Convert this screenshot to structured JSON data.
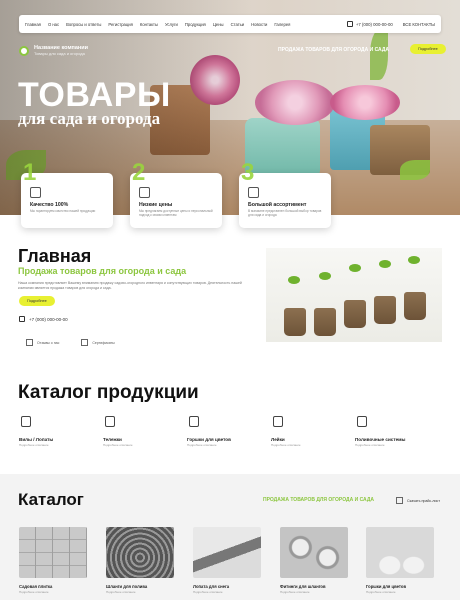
{
  "nav": {
    "items": [
      "Главная",
      "О нас",
      "Вопросы и ответы",
      "Регистрация",
      "Контакты",
      "Услуги",
      "Продукция",
      "Цены",
      "Статьи",
      "Новости",
      "Галерея"
    ],
    "phone": "+7 (000) 000-00-00",
    "contacts": "ВСЕ КОНТАКТЫ"
  },
  "brand": {
    "name": "Название компании",
    "tagline": "Товары для сада и огорода"
  },
  "hero": {
    "tag": "Продажа товаров для огорода и сада",
    "button": "Подробнее",
    "title": "ТОВАРЫ",
    "subtitle": "для сада и огорода"
  },
  "features": [
    {
      "num": "1",
      "title": "Качество 100%",
      "desc": "Мы гарантируем качество нашей продукции"
    },
    {
      "num": "2",
      "title": "Низкие цены",
      "desc": "Мы предлагаем доступные цены и персональный подход к своим клиентам"
    },
    {
      "num": "3",
      "title": "Большой ассортимент",
      "desc": "В магазине представлен большой выбор товаров для сада и огорода"
    }
  ],
  "main": {
    "title": "Главная",
    "subtitle": "Продажа товаров для огорода и сада",
    "desc": "Наша компания представляет Вашему вниманию продажу садово-огородного инвентаря и сопутствующих товаров. Деятельность нашей компании является продажа товаров для огорода и сада.",
    "button": "Подробнее",
    "phone": "+7 (000) 000-00-00",
    "links": [
      "Отзывы о нас",
      "Сертификаты"
    ]
  },
  "catalog_products": {
    "title": "Каталог продукции",
    "items": [
      {
        "title": "Вилы / Лопаты",
        "desc": "Подробное описание"
      },
      {
        "title": "Тележки",
        "desc": "Подробное описание"
      },
      {
        "title": "Горшки для цветов",
        "desc": "Подробное описание"
      },
      {
        "title": "Лейки",
        "desc": "Подробное описание"
      },
      {
        "title": "Поливочные системы",
        "desc": "Подробное описание"
      }
    ]
  },
  "catalog": {
    "title": "Каталог",
    "tag": "Продажа товаров для огорода и сада",
    "download": "Скачать прайс-лист",
    "items": [
      {
        "title": "Садовая плитка",
        "desc": "Подробное описание"
      },
      {
        "title": "Шланги для полива",
        "desc": "Подробное описание"
      },
      {
        "title": "Лопата для снега",
        "desc": "Подробное описание"
      },
      {
        "title": "Фитинги для шлангов",
        "desc": "Подробное описание"
      },
      {
        "title": "Горшки для цветов",
        "desc": "Подробное описание"
      }
    ]
  },
  "colors": {
    "accent_green": "#8cc63f",
    "button_yellow": "#e8f032"
  }
}
